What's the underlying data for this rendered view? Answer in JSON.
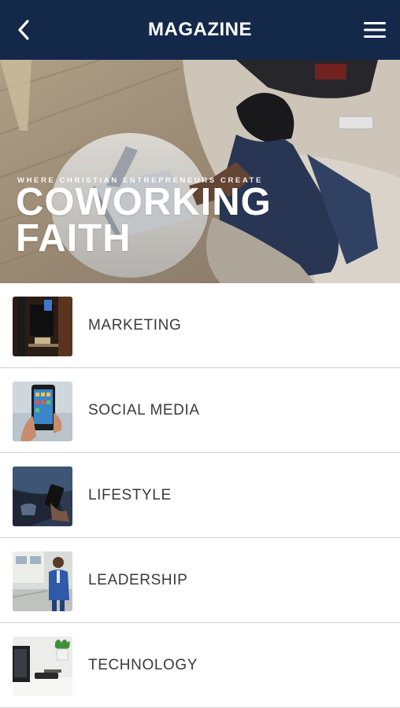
{
  "appbar": {
    "title": "MAGAZINE",
    "back_icon": "chevron-left-icon",
    "menu_icon": "hamburger-menu-icon",
    "background": "#14284a"
  },
  "hero": {
    "tagline": "WHERE CHRISTIAN ENTREPRENEURS CREATE",
    "headline_line1": "COWORKING",
    "headline_line2": "FAITH"
  },
  "categories": [
    {
      "label": "MARKETING",
      "thumb": "marketing-thumbnail"
    },
    {
      "label": "SOCIAL MEDIA",
      "thumb": "social-media-thumbnail"
    },
    {
      "label": "LIFESTYLE",
      "thumb": "lifestyle-thumbnail"
    },
    {
      "label": "LEADERSHIP",
      "thumb": "leadership-thumbnail"
    },
    {
      "label": "TECHNOLOGY",
      "thumb": "technology-thumbnail"
    }
  ]
}
